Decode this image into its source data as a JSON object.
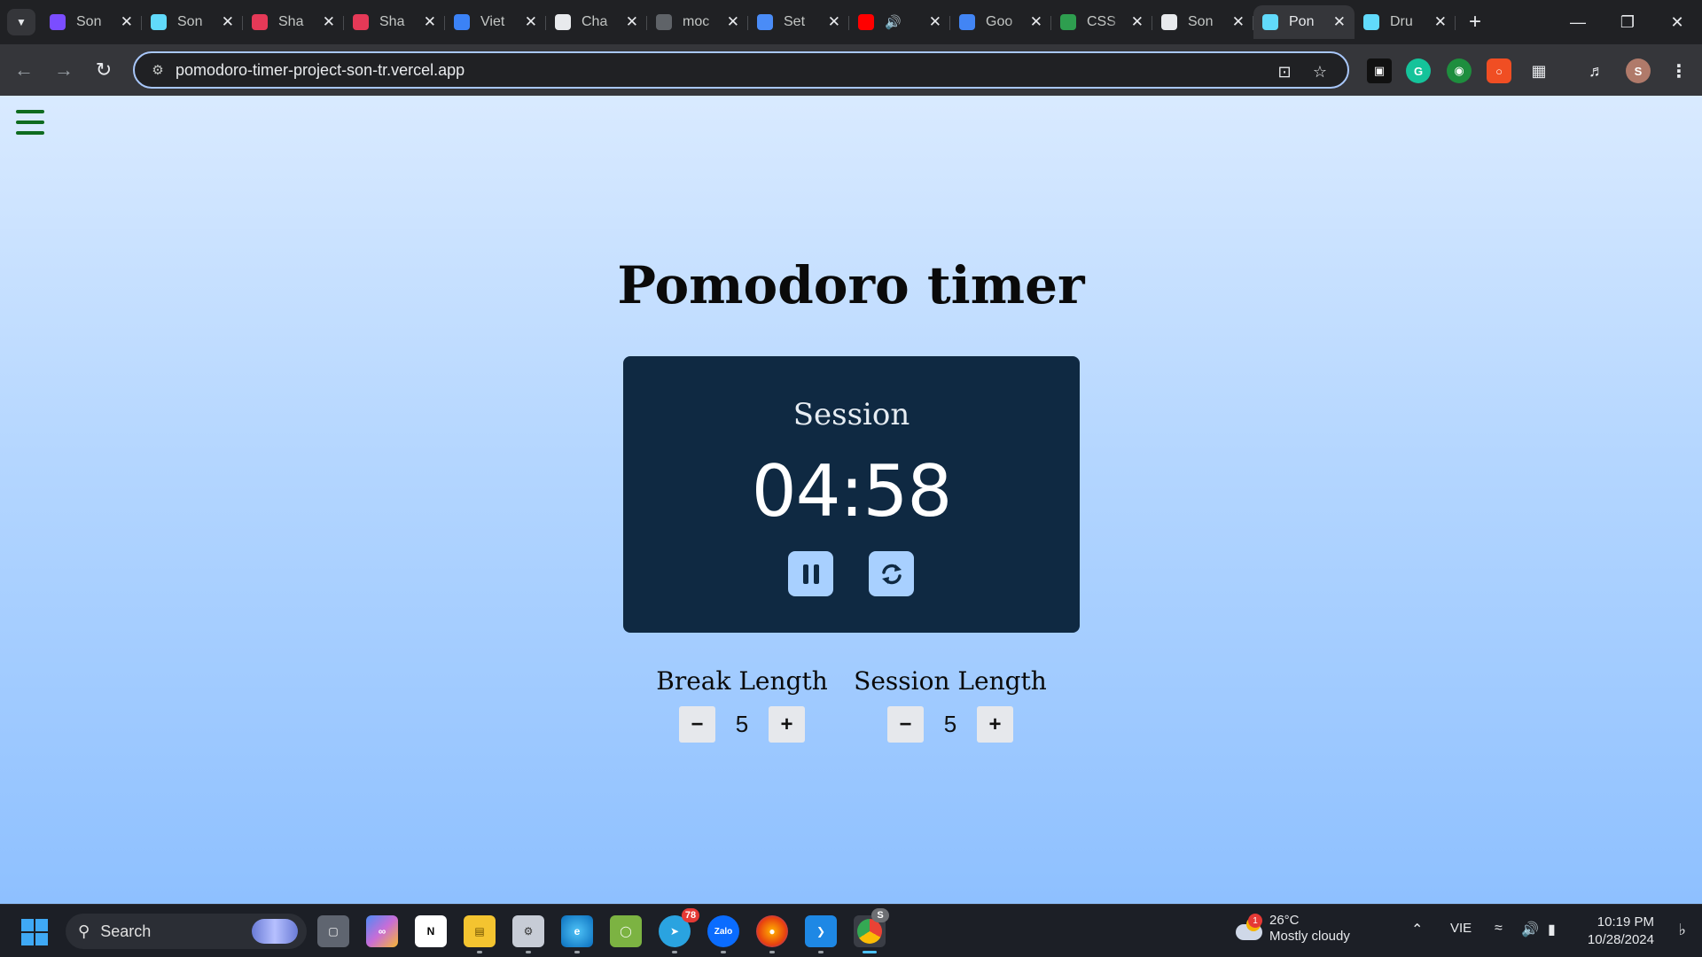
{
  "browser": {
    "tabs": [
      {
        "title": "Son",
        "favicon": "infinity-icon",
        "color": "#7b4dff"
      },
      {
        "title": "Son",
        "favicon": "react-icon",
        "color": "#61dafb"
      },
      {
        "title": "Sha",
        "favicon": "sv-icon",
        "color": "#e53957"
      },
      {
        "title": "Sha",
        "favicon": "sv-icon",
        "color": "#e53957"
      },
      {
        "title": "Viet",
        "favicon": "play-icon",
        "color": "#3b82f6"
      },
      {
        "title": "Cha",
        "favicon": "openai-icon",
        "color": "#e8eaed"
      },
      {
        "title": "moc",
        "favicon": "mock-api-icon",
        "color": "#5f6368"
      },
      {
        "title": "Set",
        "favicon": "flag-icon",
        "color": "#4a8cf7"
      },
      {
        "title": "",
        "favicon": "youtube-icon",
        "color": "#ff0000",
        "audio": true
      },
      {
        "title": "Goo",
        "favicon": "google-translate-icon",
        "color": "#4285f4"
      },
      {
        "title": "CSS",
        "favicon": "w-icon",
        "color": "#2e9e4f"
      },
      {
        "title": "Son",
        "favicon": "github-icon",
        "color": "#e8eaed"
      },
      {
        "title": "Pon",
        "favicon": "react-icon",
        "color": "#61dafb",
        "active": true
      },
      {
        "title": "Dru",
        "favicon": "react-icon",
        "color": "#61dafb"
      }
    ],
    "address_bar": {
      "url": "pomodoro-timer-project-son-tr.vercel.app"
    },
    "profile_initial": "S",
    "extensions": [
      "capture-icon",
      "grammarly-icon",
      "circle-ext-icon",
      "red-ext-icon",
      "puzzle-icon"
    ]
  },
  "app": {
    "title": "Pomodoro timer",
    "timer": {
      "label": "Session",
      "time": "04:58"
    },
    "break": {
      "label": "Break Length",
      "value": "5",
      "decrement": "−",
      "increment": "+"
    },
    "session": {
      "label": "Session Length",
      "value": "5",
      "decrement": "−",
      "increment": "+"
    }
  },
  "taskbar": {
    "search_label": "Search",
    "telegram_badge": "78",
    "chrome_badge": "S",
    "weather": {
      "alert": "1",
      "temp": "26°C",
      "desc": "Mostly cloudy"
    },
    "language": "VIE",
    "time": "10:19 PM",
    "date": "10/28/2024"
  }
}
